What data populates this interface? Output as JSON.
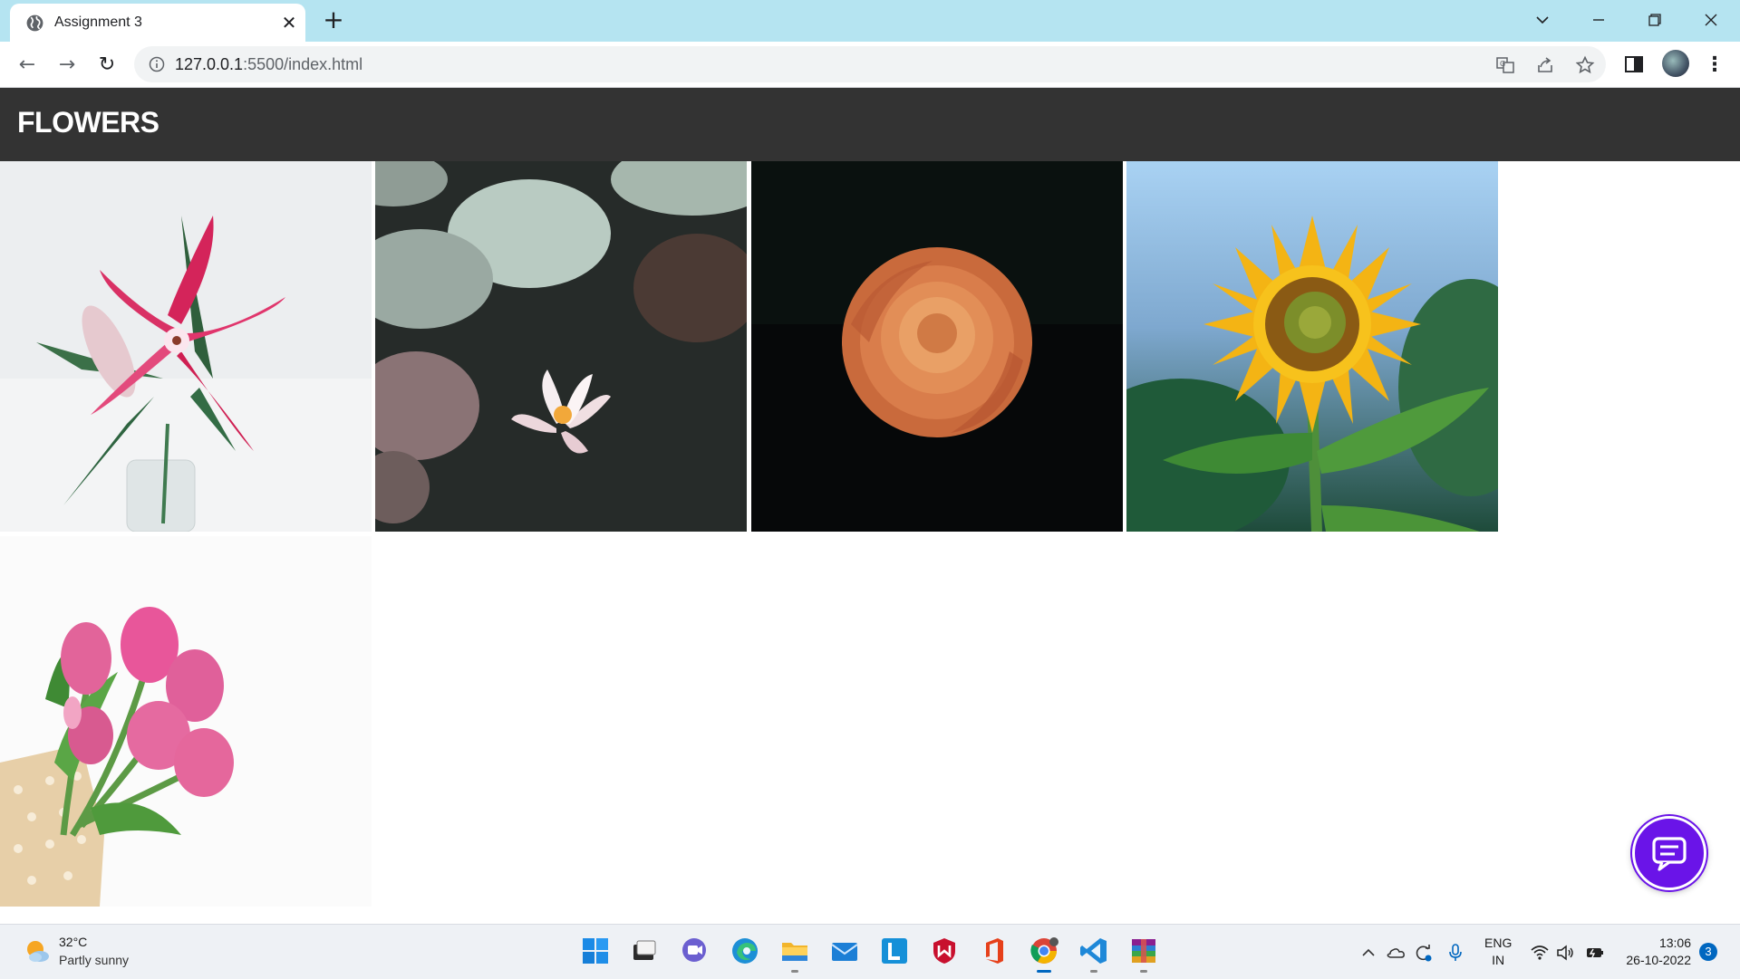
{
  "browser": {
    "tab_title": "Assignment 3",
    "url_host": "127.0.0.1",
    "url_rest": ":5500/index.html"
  },
  "page": {
    "header_title": "FLOWERS",
    "gallery": [
      {
        "subject": "pink lily"
      },
      {
        "subject": "water lily"
      },
      {
        "subject": "orange rose"
      },
      {
        "subject": "sunflower"
      },
      {
        "subject": "pink tulips"
      }
    ]
  },
  "taskbar": {
    "weather_temp": "32°C",
    "weather_desc": "Partly sunny",
    "lang_line1": "ENG",
    "lang_line2": "IN",
    "time": "13:06",
    "date": "26-10-2022",
    "notifications": "3"
  },
  "colors": {
    "titlebar": "#b5e4f1",
    "header_bg": "#333333",
    "chat_button": "#6a14e8"
  }
}
